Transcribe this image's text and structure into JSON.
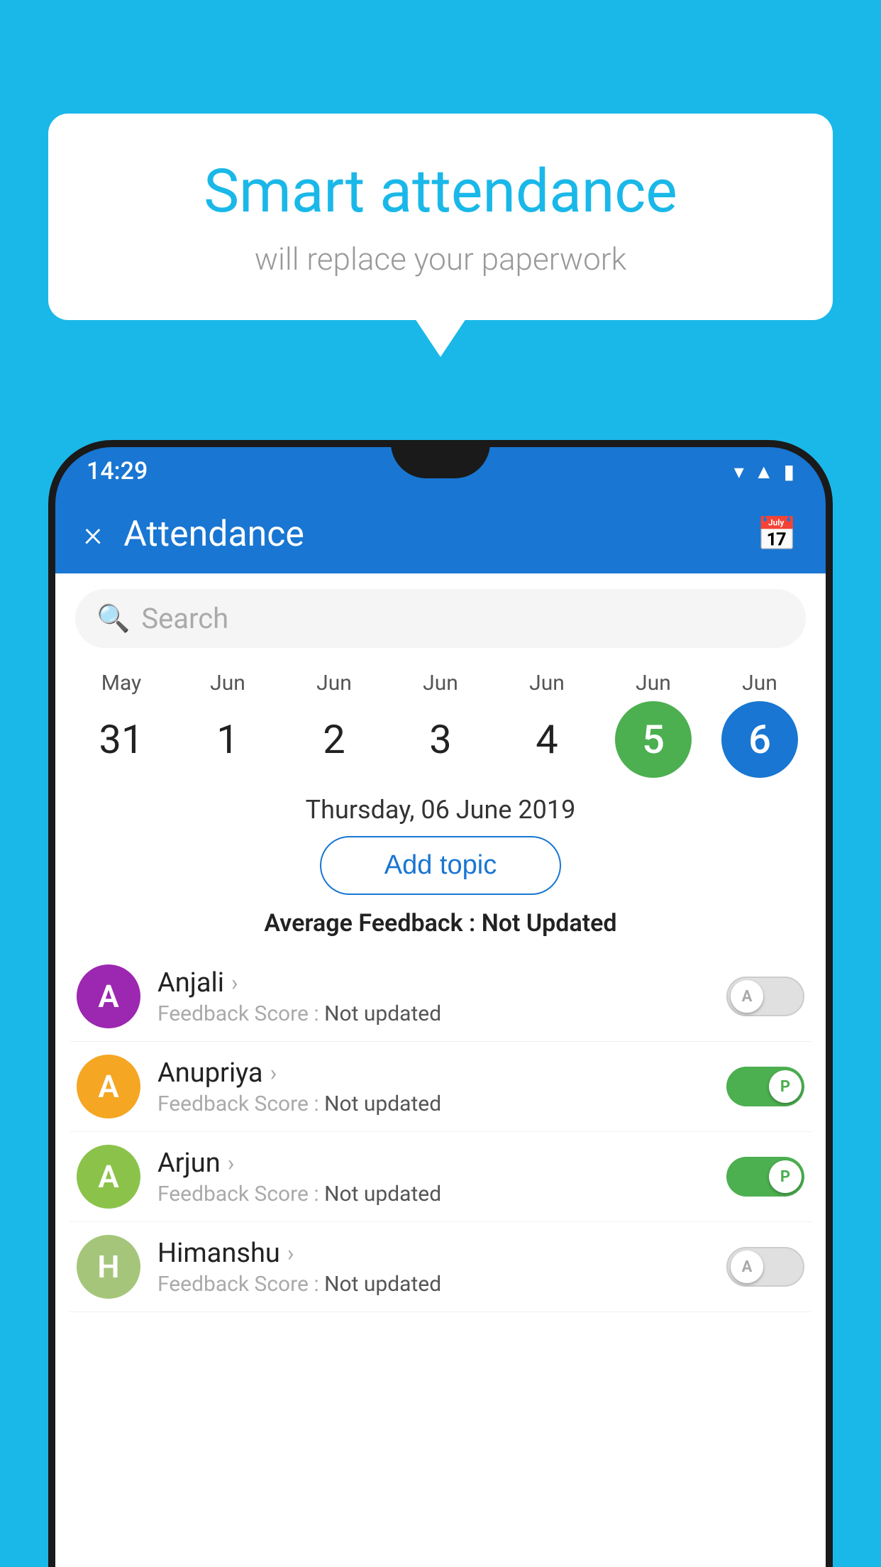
{
  "background_color": "#1ab8e8",
  "speech_bubble": {
    "title": "Smart attendance",
    "subtitle": "will replace your paperwork"
  },
  "status_bar": {
    "time": "14:29",
    "icons": [
      "wifi",
      "signal",
      "battery"
    ]
  },
  "app_header": {
    "title": "Attendance",
    "close_label": "×",
    "calendar_icon": "📅"
  },
  "search": {
    "placeholder": "Search"
  },
  "calendar": {
    "days": [
      {
        "month": "May",
        "date": "31",
        "state": "normal"
      },
      {
        "month": "Jun",
        "date": "1",
        "state": "normal"
      },
      {
        "month": "Jun",
        "date": "2",
        "state": "normal"
      },
      {
        "month": "Jun",
        "date": "3",
        "state": "normal"
      },
      {
        "month": "Jun",
        "date": "4",
        "state": "normal"
      },
      {
        "month": "Jun",
        "date": "5",
        "state": "today"
      },
      {
        "month": "Jun",
        "date": "6",
        "state": "selected"
      }
    ]
  },
  "selected_date_label": "Thursday, 06 June 2019",
  "add_topic_label": "Add topic",
  "average_feedback": {
    "label": "Average Feedback :",
    "value": "Not Updated"
  },
  "students": [
    {
      "name": "Anjali",
      "avatar_letter": "A",
      "avatar_color": "#9c27b0",
      "feedback_label": "Feedback Score :",
      "feedback_value": "Not updated",
      "toggle_state": "off",
      "toggle_letter": "A"
    },
    {
      "name": "Anupriya",
      "avatar_letter": "A",
      "avatar_color": "#f5a623",
      "feedback_label": "Feedback Score :",
      "feedback_value": "Not updated",
      "toggle_state": "on",
      "toggle_letter": "P"
    },
    {
      "name": "Arjun",
      "avatar_letter": "A",
      "avatar_color": "#8bc34a",
      "feedback_label": "Feedback Score :",
      "feedback_value": "Not updated",
      "toggle_state": "on",
      "toggle_letter": "P"
    },
    {
      "name": "Himanshu",
      "avatar_letter": "H",
      "avatar_color": "#a5c67a",
      "feedback_label": "Feedback Score :",
      "feedback_value": "Not updated",
      "toggle_state": "off",
      "toggle_letter": "A"
    }
  ]
}
